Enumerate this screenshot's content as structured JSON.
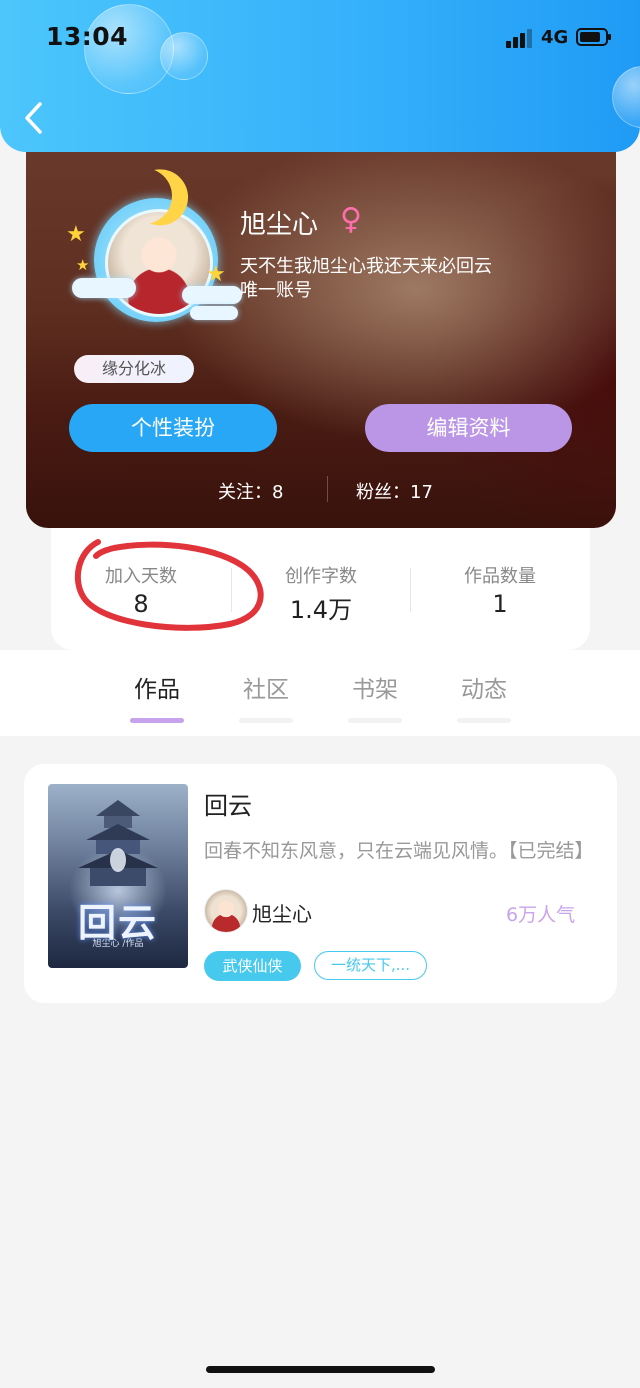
{
  "status_bar": {
    "time": "13:04",
    "network": "4G"
  },
  "profile": {
    "nickname": "旭尘心",
    "gender_symbol": "♀",
    "bio_line1": "天不生我旭尘心我还天来必回云",
    "bio_line2": "唯一账号",
    "badge": "缘分化冰",
    "dress_button": "个性装扮",
    "edit_button": "编辑资料",
    "following": "关注：8",
    "fans": "粉丝：17"
  },
  "stats": [
    {
      "label": "加入天数",
      "value": "8"
    },
    {
      "label": "创作字数",
      "value": "1.4万"
    },
    {
      "label": "作品数量",
      "value": "1"
    }
  ],
  "tabs": [
    {
      "label": "作品",
      "active": true
    },
    {
      "label": "社区",
      "active": false
    },
    {
      "label": "书架",
      "active": false
    },
    {
      "label": "动态",
      "active": false
    }
  ],
  "work": {
    "title": "回云",
    "cover_title": "回云",
    "cover_sub": "旭尘心 /作品",
    "description": "回春不知东风意，只在云端见风情。【已完结】",
    "author": "旭尘心",
    "popularity": "6万人气",
    "tags": [
      "武侠仙侠",
      "一统天下,..."
    ]
  },
  "colors": {
    "header": "#36b1fb",
    "dress_button": "#27a7f5",
    "edit_button": "#bb96e6",
    "tab_indicator": "#c6a3ec",
    "tag": "#47c9ee",
    "popularity": "#c9a4ec",
    "annotation_circle": "#e0343a"
  }
}
